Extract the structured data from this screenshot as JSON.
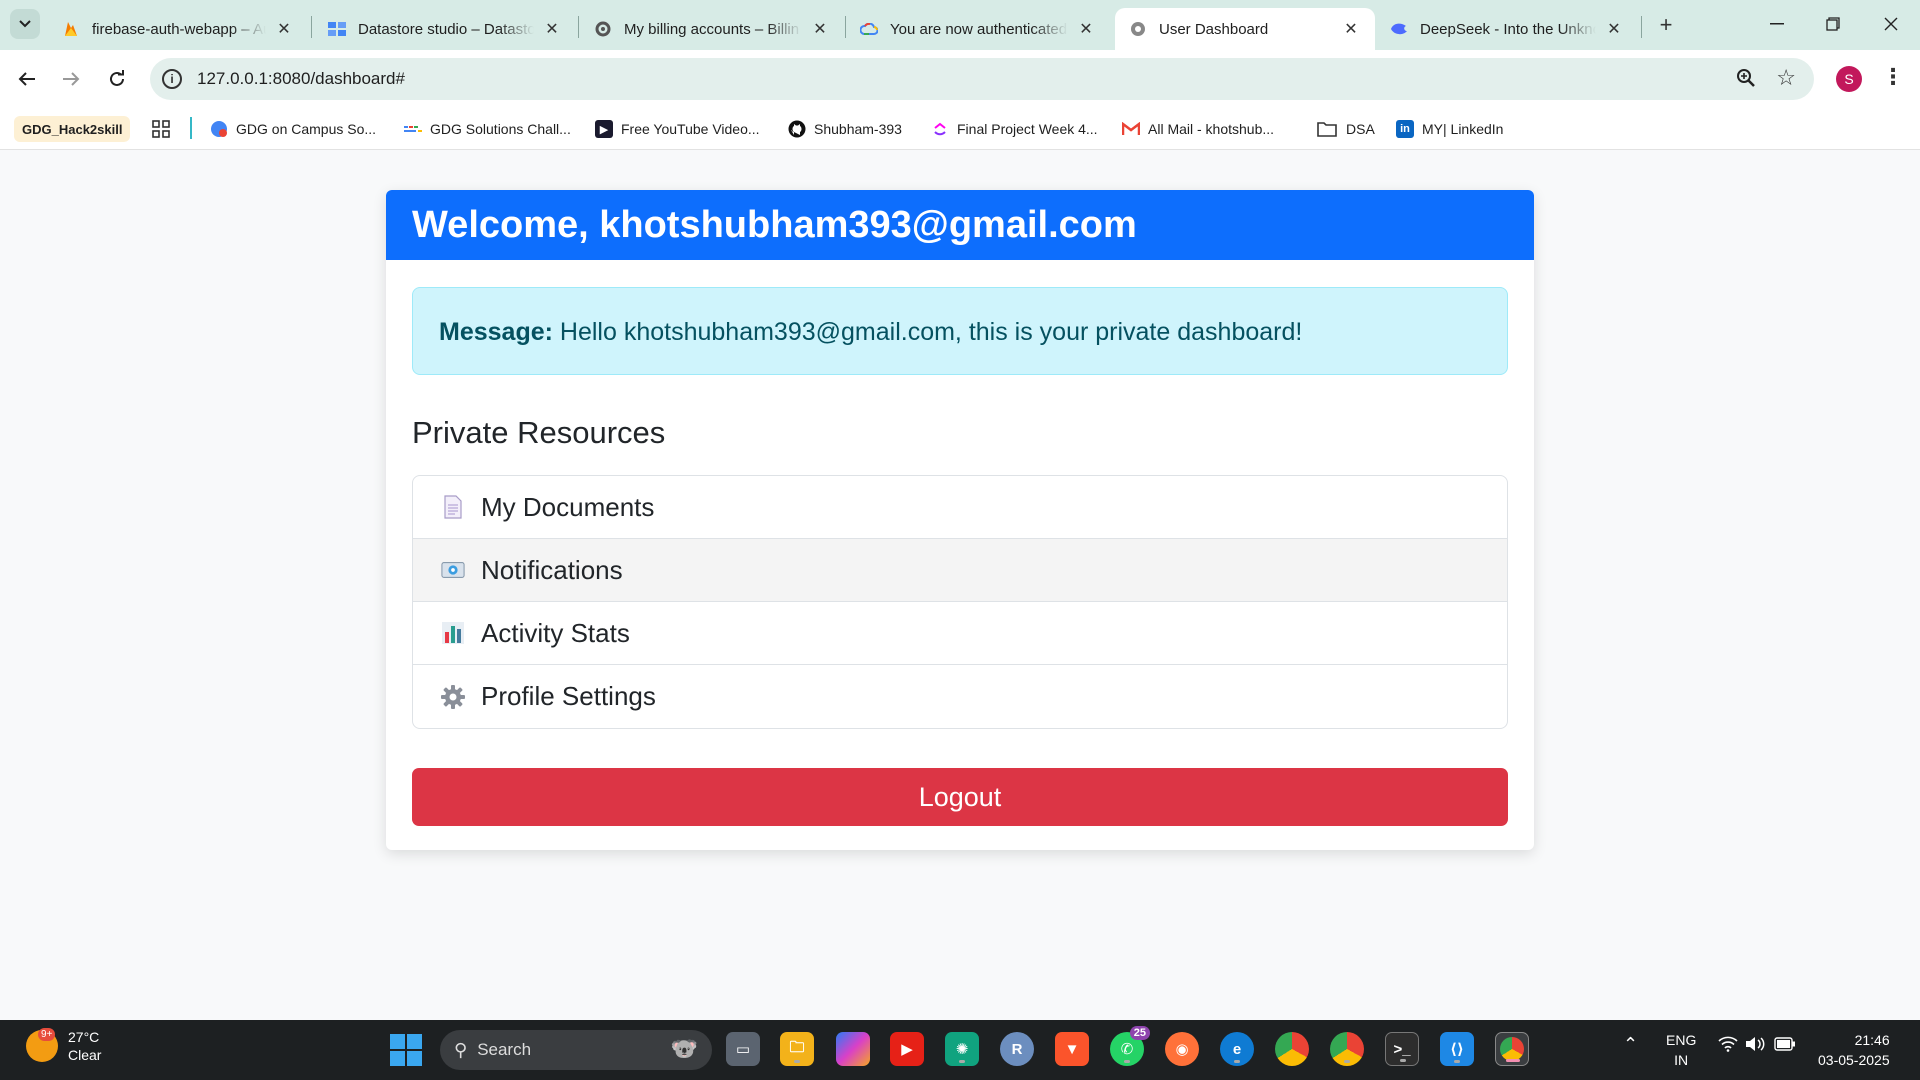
{
  "browser": {
    "tabs": [
      {
        "title": "firebase-auth-webapp – Au",
        "icon": "firebase-icon"
      },
      {
        "title": "Datastore studio – Datasto",
        "icon": "datastore-icon"
      },
      {
        "title": "My billing accounts – Billin",
        "icon": "settings-icon"
      },
      {
        "title": "You are now authenticated",
        "icon": "google-cloud-icon"
      },
      {
        "title": "User Dashboard",
        "icon": "globe-icon",
        "active": true
      },
      {
        "title": "DeepSeek - Into the Unkno",
        "icon": "deepseek-icon"
      }
    ],
    "url": "127.0.0.1:8080/dashboard#",
    "profile_initial": "S",
    "bookmarks": [
      {
        "label": "GDG_Hack2skill"
      },
      {
        "label": "GDG on Campus So..."
      },
      {
        "label": "GDG Solutions Chall..."
      },
      {
        "label": "Free YouTube Video..."
      },
      {
        "label": "Shubham-393"
      },
      {
        "label": "Final Project Week 4..."
      },
      {
        "label": "All Mail - khotshub..."
      },
      {
        "label": "DSA"
      },
      {
        "label": "MY| LinkedIn"
      }
    ]
  },
  "page": {
    "welcome": "Welcome, khotshubham393@gmail.com",
    "message_label": "Message:",
    "message_text": "Hello khotshubham393@gmail.com, this is your private dashboard!",
    "section_title": "Private Resources",
    "resources": [
      {
        "label": "My Documents",
        "icon": "document-icon"
      },
      {
        "label": "Notifications",
        "icon": "envelope-icon"
      },
      {
        "label": "Activity Stats",
        "icon": "bar-chart-icon"
      },
      {
        "label": "Profile Settings",
        "icon": "gear-icon"
      }
    ],
    "logout_label": "Logout",
    "colors": {
      "primary": "#0d6efd",
      "info_bg": "#cff4fc",
      "danger": "#dc3545"
    }
  },
  "taskbar": {
    "weather_badge": "9+",
    "temperature": "27°C",
    "condition": "Clear",
    "search_label": "Search",
    "whatsapp_badge": "25",
    "language": "ENG",
    "region": "IN",
    "time": "21:46",
    "date": "03-05-2025"
  }
}
